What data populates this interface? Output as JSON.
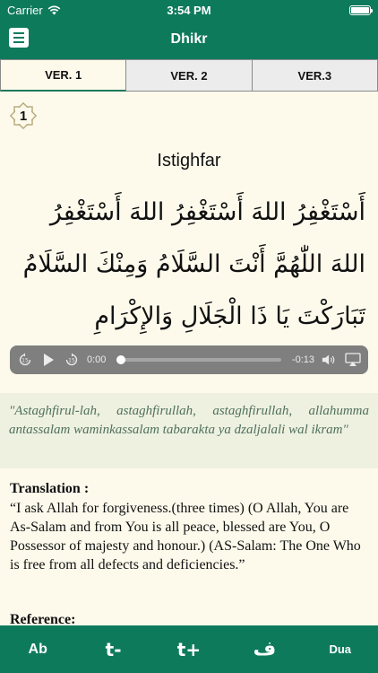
{
  "status_bar": {
    "carrier": "Carrier",
    "time": "3:54 PM"
  },
  "header": {
    "title": "Dhikr"
  },
  "tabs": [
    {
      "label": "VER. 1",
      "active": true
    },
    {
      "label": "VER. 2",
      "active": false
    },
    {
      "label": "VER.3",
      "active": false
    }
  ],
  "dhikr": {
    "number": "1",
    "title": "Istighfar",
    "arabic": "أَسْتَغْفِرُ اللهَ أَسْتَغْفِرُ اللهَ أَسْتَغْفِرُ اللهَ اللّٰهُمَّ أَنْتَ السَّلَامُ وَمِنْكَ السَّلَامُ تَبَارَكْتَ يَا ذَا الْجَلَالِ وَالإِكْرَامِ",
    "transliteration": "\"Astaghfirul-lah, astaghfirullah, astaghfirullah, allahumma antassalam waminkassalam tabarakta ya dzaljalali wal ikram\"",
    "translation_heading": "Translation :",
    "translation": "“I ask Allah for forgiveness.(three times) (O Allah, You are As-Salam and from You is all peace, blessed are You, O Possessor of majesty and honour.) (AS-Salam: The One Who is free from all defects and deficiencies.”",
    "reference_heading": "Reference:"
  },
  "player": {
    "current_time": "0:00",
    "remaining_time": "-0:13",
    "progress": 0,
    "skip_back_seconds": "15",
    "skip_forward_seconds": "15"
  },
  "toolbar": {
    "font_style": "Ab",
    "font_decrease": "t-",
    "font_increase": "t+",
    "arabic_toggle": "ف",
    "dua": "Dua"
  },
  "colors": {
    "primary": "#0e7a5c",
    "background": "#fdfaec",
    "transliteration_bg": "#eef1df",
    "transliteration_text": "#4f6f5f",
    "player_bg": "#7f7f7f"
  }
}
